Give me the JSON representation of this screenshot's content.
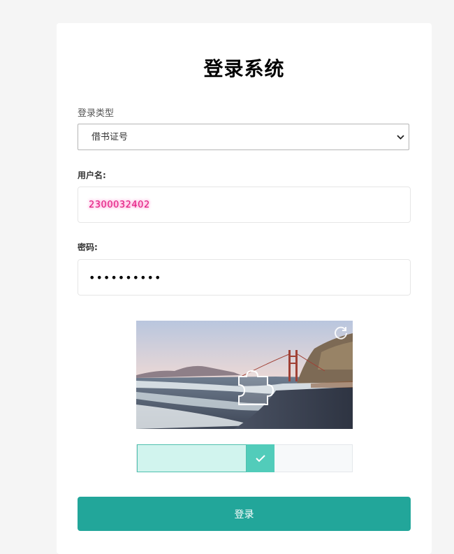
{
  "form": {
    "title": "登录系统",
    "login_type_label": "登录类型",
    "login_type_value": "借书证号",
    "username_label": "用户名:",
    "username_value": "2300032402",
    "password_label": "密码:",
    "password_value": "••••••••••"
  },
  "captcha": {
    "icons": {
      "refresh": "refresh-icon",
      "puzzle": "puzzle-piece-icon",
      "check": "check-icon"
    },
    "slider_progress": 0.51
  },
  "submit_label": "登录",
  "colors": {
    "accent": "#22a69a",
    "slider_fill": "#d1f4ee",
    "slider_handle": "#52ccba",
    "page_bg": "#f5f5f5"
  }
}
